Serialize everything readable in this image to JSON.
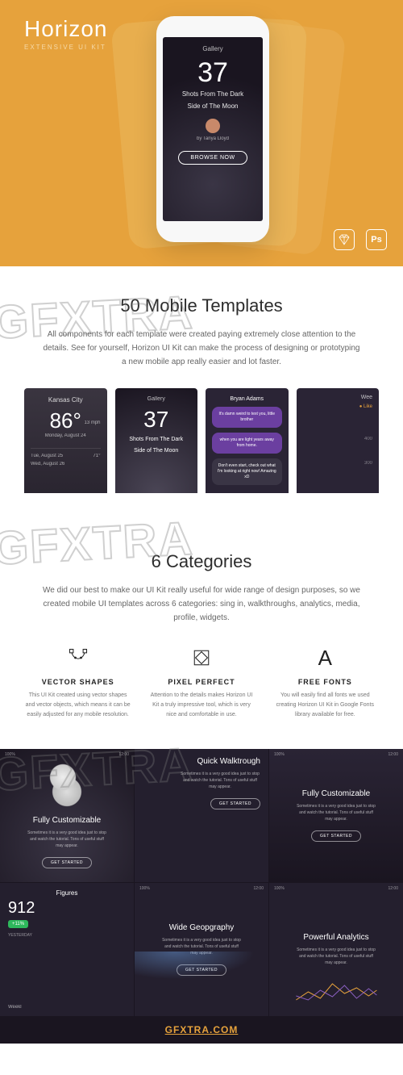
{
  "hero": {
    "title": "Horizon",
    "subtitle": "EXTENSIVE UI KIT",
    "phone": {
      "tab": "Gallery",
      "number": "37",
      "line1": "Shots From The Dark",
      "line2": "Side of The Moon",
      "byline": "by Tanya Lloyd",
      "button": "BROWSE NOW"
    },
    "ps_label": "Ps"
  },
  "watermark": "GFXTRA",
  "section1": {
    "title": "50 Mobile Templates",
    "body": "All components for each template were created paying extremely close attention to the details. See for yourself, Horizon UI Kit can make the process of designing or prototyping a new mobile app really easier and lot faster."
  },
  "thumbs": {
    "weather": {
      "city": "Kansas City",
      "temp": "86°",
      "date": "Monday, August 24",
      "wind": "13 mph",
      "row1a": "Tue, August 25",
      "row1b": "71°",
      "row2a": "Wed, August 26"
    },
    "gallery": {
      "tab": "Gallery",
      "num": "37",
      "line1": "Shots From The Dark",
      "line2": "Side of The Moon"
    },
    "chat": {
      "name": "Bryan Adams",
      "msg1": "It's damn weird to text you, little brother",
      "msg2": "when you are light years away from home.",
      "msg3": "Don't even start, check out what I'm looking at right now! Amazing xD"
    },
    "week": {
      "label": "Wee",
      "like": "● Like",
      "n1": "400",
      "n2": "300"
    }
  },
  "section2": {
    "title": "6 Categories",
    "body": "We did our best to make our UI Kit really useful for wide range of design purposes, so we created mobile UI templates across 6 categories: sing in, walkthroughs, analytics, media, profile, widgets."
  },
  "features": [
    {
      "title": "VECTOR SHAPES",
      "body": "This UI Kit created using vector shapes and vector objects, which means it can be easily adjusted for any mobile resolution."
    },
    {
      "title": "PIXEL PERFECT",
      "body": "Attention to the details makes Horizon UI Kit a truly impressive tool, which is very nice and comfortable in use."
    },
    {
      "title": "FREE FONTS",
      "body": "You will easily find all fonts we used creating Horizon UI Kit in Google Fonts library available for free."
    }
  ],
  "dark": {
    "status_left": "100%",
    "status_time": "12:00",
    "card_body": "Sometimes it is a very good idea just to stop and watch the tutorial. Tons of useful stuff may appear.",
    "btn": "GET STARTED",
    "cards": {
      "c1_title": "Fully Customizable",
      "c2_title": "Quick Walktrough",
      "c3_title": "Fully Customizable",
      "c4_title": "Wide Geopgraphy",
      "c5_num": "912",
      "c5_badge": "+11%",
      "c5_yest": "YESTERDAY",
      "c5_label": "Figures",
      "c5_week": "Weekl",
      "c6_title": "Powerful Analytics"
    }
  },
  "footer": "GFXTRA.COM",
  "colors": {
    "accent": "#e6a23c",
    "dark": "#1a1520",
    "purple": "#6b3fa0"
  }
}
